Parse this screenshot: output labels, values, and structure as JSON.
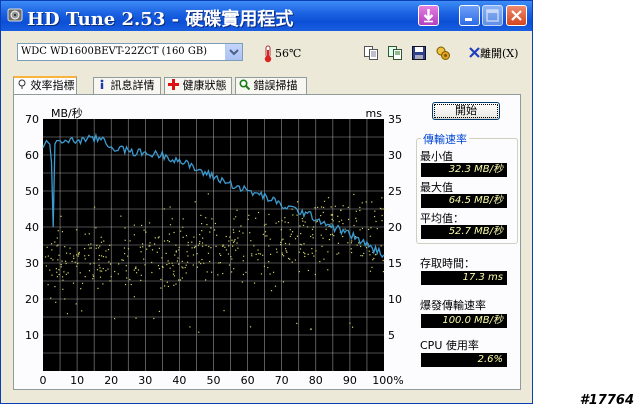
{
  "window": {
    "title": "HD Tune 2.53 - 硬碟實用程式"
  },
  "toolbar": {
    "drive": "WDC WD1600BEVT-22ZCT (160 GB)",
    "temperature": "56℃",
    "exit_label": "離開(X)"
  },
  "tabs": [
    {
      "label": "效率指標",
      "active": true
    },
    {
      "label": "訊息詳情",
      "active": false
    },
    {
      "label": "健康狀態",
      "active": false
    },
    {
      "label": "錯誤掃描",
      "active": false
    }
  ],
  "side": {
    "start_button": "開始",
    "transfer_rate_title": "傳輸速率",
    "min_label": "最小值",
    "min_value": "32.3 MB/秒",
    "max_label": "最大值",
    "max_value": "64.5 MB/秒",
    "avg_label": "平均值：",
    "avg_value": "52.7 MB/秒",
    "access_time_label": "存取時間：",
    "access_time_value": "17.3 ms",
    "burst_label": "爆發傳輸速率",
    "burst_value": "100.0 MB/秒",
    "cpu_label": "CPU 使用率",
    "cpu_value": "2.6%"
  },
  "watermark": "#17764",
  "chart_data": {
    "type": "line",
    "left_axis_label": "MB/秒",
    "right_axis_label": "ms",
    "x_ticks": [
      "0",
      "10",
      "20",
      "30",
      "40",
      "50",
      "60",
      "70",
      "80",
      "90",
      "100%"
    ],
    "y_left_ticks": [
      "10",
      "20",
      "30",
      "40",
      "50",
      "60",
      "70"
    ],
    "y_right_ticks": [
      "5",
      "10",
      "15",
      "20",
      "25",
      "30",
      "35"
    ],
    "xlim": [
      0,
      100
    ],
    "ylim_left": [
      0,
      70
    ],
    "ylim_right": [
      0,
      35
    ],
    "grid": true,
    "colors": {
      "background": "#000000",
      "grid": "#c8c8c8",
      "transfer": "#3c9bd0",
      "access": "#d4d46a"
    },
    "series": [
      {
        "name": "傳輸速率",
        "axis": "left",
        "x": [
          0,
          1,
          2,
          2.5,
          3,
          3.5,
          4,
          6,
          10,
          15,
          18,
          19,
          20,
          22,
          25,
          30,
          35,
          40,
          45,
          50,
          55,
          60,
          65,
          70,
          75,
          80,
          85,
          90,
          95,
          100
        ],
        "y": [
          62,
          64,
          63,
          58,
          40,
          63,
          64,
          64,
          64,
          64.5,
          64.5,
          63,
          62,
          62,
          61,
          60.5,
          60,
          58.5,
          56,
          54,
          52,
          50,
          48.5,
          46,
          44.5,
          42.5,
          40,
          38,
          35,
          32.3
        ]
      }
    ]
  }
}
